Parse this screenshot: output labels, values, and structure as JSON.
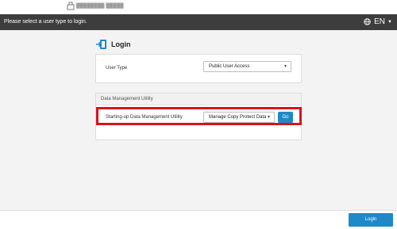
{
  "header": {
    "prompt": "Please select a user type to login.",
    "language": "EN",
    "language_icon": "globe-icon",
    "background": "#3d3d3d"
  },
  "login": {
    "title": "Login",
    "icon": "login-icon"
  },
  "user_type": {
    "label": "User Type",
    "selected": "Public User Access"
  },
  "data_management": {
    "section_title": "Data Management Utility",
    "label": "Starting-up Data Management Utility",
    "selected": "Manage Copy Protect Data",
    "go_label": "Go"
  },
  "footer": {
    "login_button": "Login"
  },
  "colors": {
    "accent": "#1f88c8",
    "highlight": "#d9121a"
  }
}
